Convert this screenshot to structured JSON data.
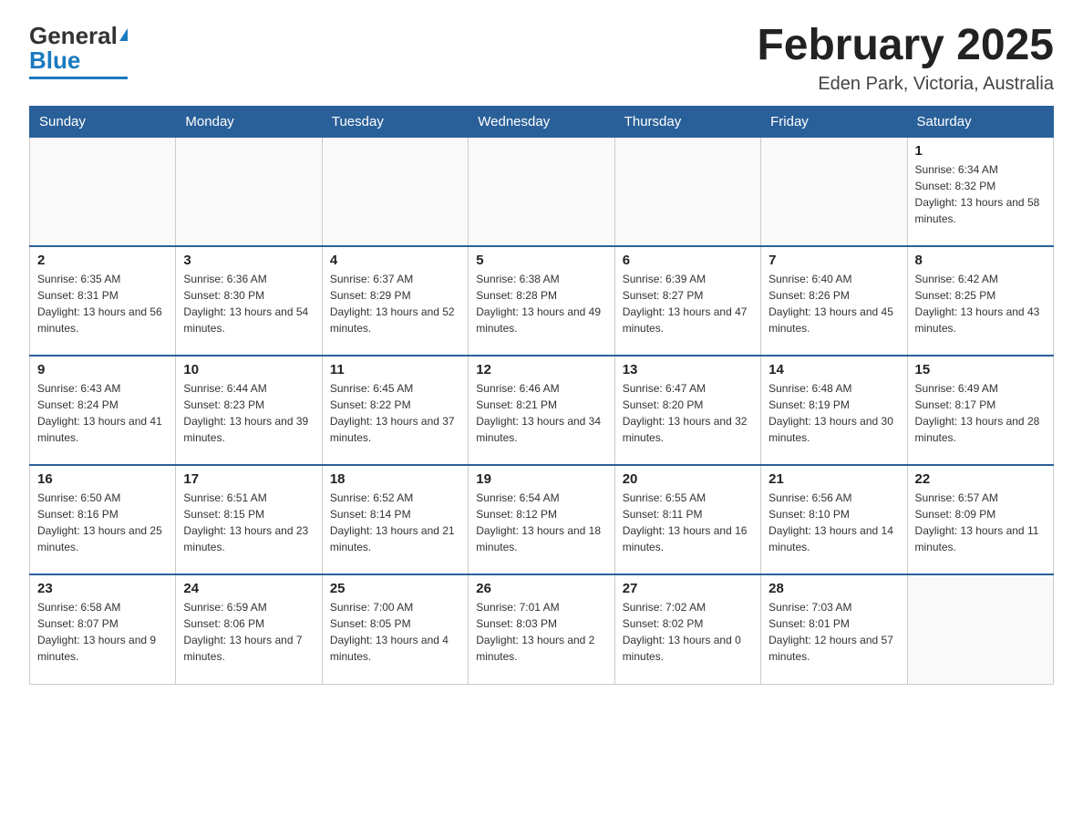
{
  "header": {
    "logo_general": "General",
    "logo_blue": "Blue",
    "month_title": "February 2025",
    "location": "Eden Park, Victoria, Australia"
  },
  "weekdays": [
    "Sunday",
    "Monday",
    "Tuesday",
    "Wednesday",
    "Thursday",
    "Friday",
    "Saturday"
  ],
  "weeks": [
    [
      {
        "day": "",
        "info": ""
      },
      {
        "day": "",
        "info": ""
      },
      {
        "day": "",
        "info": ""
      },
      {
        "day": "",
        "info": ""
      },
      {
        "day": "",
        "info": ""
      },
      {
        "day": "",
        "info": ""
      },
      {
        "day": "1",
        "info": "Sunrise: 6:34 AM\nSunset: 8:32 PM\nDaylight: 13 hours and 58 minutes."
      }
    ],
    [
      {
        "day": "2",
        "info": "Sunrise: 6:35 AM\nSunset: 8:31 PM\nDaylight: 13 hours and 56 minutes."
      },
      {
        "day": "3",
        "info": "Sunrise: 6:36 AM\nSunset: 8:30 PM\nDaylight: 13 hours and 54 minutes."
      },
      {
        "day": "4",
        "info": "Sunrise: 6:37 AM\nSunset: 8:29 PM\nDaylight: 13 hours and 52 minutes."
      },
      {
        "day": "5",
        "info": "Sunrise: 6:38 AM\nSunset: 8:28 PM\nDaylight: 13 hours and 49 minutes."
      },
      {
        "day": "6",
        "info": "Sunrise: 6:39 AM\nSunset: 8:27 PM\nDaylight: 13 hours and 47 minutes."
      },
      {
        "day": "7",
        "info": "Sunrise: 6:40 AM\nSunset: 8:26 PM\nDaylight: 13 hours and 45 minutes."
      },
      {
        "day": "8",
        "info": "Sunrise: 6:42 AM\nSunset: 8:25 PM\nDaylight: 13 hours and 43 minutes."
      }
    ],
    [
      {
        "day": "9",
        "info": "Sunrise: 6:43 AM\nSunset: 8:24 PM\nDaylight: 13 hours and 41 minutes."
      },
      {
        "day": "10",
        "info": "Sunrise: 6:44 AM\nSunset: 8:23 PM\nDaylight: 13 hours and 39 minutes."
      },
      {
        "day": "11",
        "info": "Sunrise: 6:45 AM\nSunset: 8:22 PM\nDaylight: 13 hours and 37 minutes."
      },
      {
        "day": "12",
        "info": "Sunrise: 6:46 AM\nSunset: 8:21 PM\nDaylight: 13 hours and 34 minutes."
      },
      {
        "day": "13",
        "info": "Sunrise: 6:47 AM\nSunset: 8:20 PM\nDaylight: 13 hours and 32 minutes."
      },
      {
        "day": "14",
        "info": "Sunrise: 6:48 AM\nSunset: 8:19 PM\nDaylight: 13 hours and 30 minutes."
      },
      {
        "day": "15",
        "info": "Sunrise: 6:49 AM\nSunset: 8:17 PM\nDaylight: 13 hours and 28 minutes."
      }
    ],
    [
      {
        "day": "16",
        "info": "Sunrise: 6:50 AM\nSunset: 8:16 PM\nDaylight: 13 hours and 25 minutes."
      },
      {
        "day": "17",
        "info": "Sunrise: 6:51 AM\nSunset: 8:15 PM\nDaylight: 13 hours and 23 minutes."
      },
      {
        "day": "18",
        "info": "Sunrise: 6:52 AM\nSunset: 8:14 PM\nDaylight: 13 hours and 21 minutes."
      },
      {
        "day": "19",
        "info": "Sunrise: 6:54 AM\nSunset: 8:12 PM\nDaylight: 13 hours and 18 minutes."
      },
      {
        "day": "20",
        "info": "Sunrise: 6:55 AM\nSunset: 8:11 PM\nDaylight: 13 hours and 16 minutes."
      },
      {
        "day": "21",
        "info": "Sunrise: 6:56 AM\nSunset: 8:10 PM\nDaylight: 13 hours and 14 minutes."
      },
      {
        "day": "22",
        "info": "Sunrise: 6:57 AM\nSunset: 8:09 PM\nDaylight: 13 hours and 11 minutes."
      }
    ],
    [
      {
        "day": "23",
        "info": "Sunrise: 6:58 AM\nSunset: 8:07 PM\nDaylight: 13 hours and 9 minutes."
      },
      {
        "day": "24",
        "info": "Sunrise: 6:59 AM\nSunset: 8:06 PM\nDaylight: 13 hours and 7 minutes."
      },
      {
        "day": "25",
        "info": "Sunrise: 7:00 AM\nSunset: 8:05 PM\nDaylight: 13 hours and 4 minutes."
      },
      {
        "day": "26",
        "info": "Sunrise: 7:01 AM\nSunset: 8:03 PM\nDaylight: 13 hours and 2 minutes."
      },
      {
        "day": "27",
        "info": "Sunrise: 7:02 AM\nSunset: 8:02 PM\nDaylight: 13 hours and 0 minutes."
      },
      {
        "day": "28",
        "info": "Sunrise: 7:03 AM\nSunset: 8:01 PM\nDaylight: 12 hours and 57 minutes."
      },
      {
        "day": "",
        "info": ""
      }
    ]
  ]
}
